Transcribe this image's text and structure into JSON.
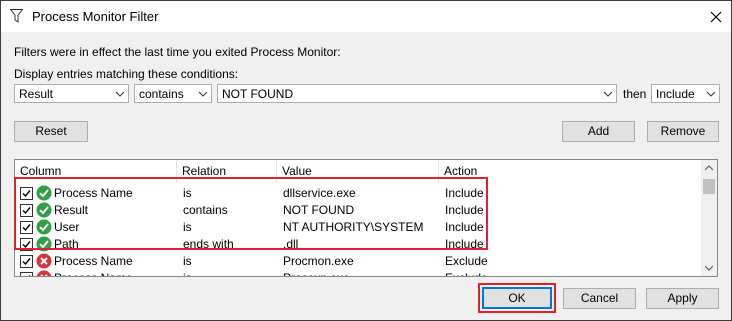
{
  "window": {
    "title": "Process Monitor Filter"
  },
  "info_text": "Filters were in effect the last time you exited Process Monitor:",
  "conditions_label": "Display entries matching these conditions:",
  "filter": {
    "column_value": "Result",
    "relation_value": "contains",
    "value_value": "NOT FOUND",
    "then_label": "then",
    "action_value": "Include"
  },
  "buttons": {
    "reset": "Reset",
    "add": "Add",
    "remove": "Remove",
    "ok": "OK",
    "cancel": "Cancel",
    "apply": "Apply"
  },
  "table": {
    "headers": [
      "Column",
      "Relation",
      "Value",
      "Action"
    ],
    "rows": [
      {
        "checked": true,
        "status": "include-icon",
        "column": "Process Name",
        "relation": "is",
        "value": "dllservice.exe",
        "action": "Include"
      },
      {
        "checked": true,
        "status": "include-icon",
        "column": "Result",
        "relation": "contains",
        "value": "NOT FOUND",
        "action": "Include"
      },
      {
        "checked": true,
        "status": "include-icon",
        "column": "User",
        "relation": "is",
        "value": "NT AUTHORITY\\SYSTEM",
        "action": "Include"
      },
      {
        "checked": true,
        "status": "include-icon",
        "column": "Path",
        "relation": "ends with",
        "value": ".dll",
        "action": "Include"
      },
      {
        "checked": true,
        "status": "exclude-icon",
        "column": "Process Name",
        "relation": "is",
        "value": "Procmon.exe",
        "action": "Exclude"
      },
      {
        "checked": true,
        "status": "exclude-icon",
        "column": "Process Name",
        "relation": "is",
        "value": "Procexp.exe",
        "action": "Exclude"
      }
    ]
  },
  "colors": {
    "highlight": "#d9232e",
    "include": "#2ea043",
    "exclude": "#d9343a",
    "focus": "#0078d7"
  }
}
